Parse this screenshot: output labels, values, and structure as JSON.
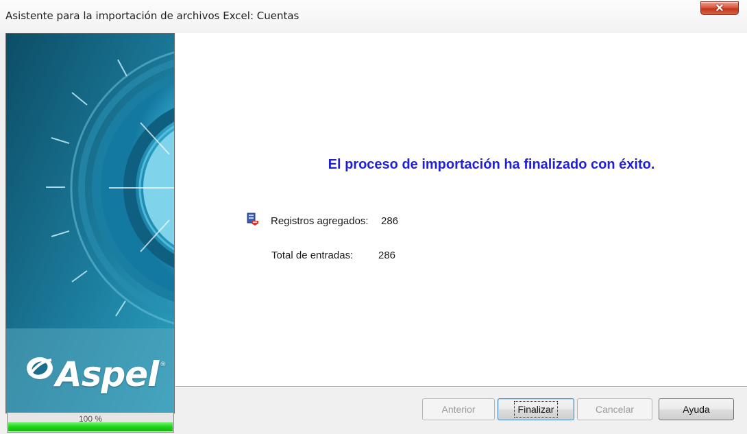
{
  "window": {
    "title": "Asistente para la importación de archivos Excel: Cuentas",
    "close_icon": "close-x-icon"
  },
  "banner": {
    "logo_text": "Aspel",
    "logo_registered": "®",
    "progress_label": "100 %",
    "progress_value": 1.0,
    "progress_color": "#1ed41a"
  },
  "main": {
    "headline": "El proceso de importación ha finalizado con éxito.",
    "headline_color": "#1f1fd8",
    "stats": {
      "records_icon": "records-added-icon",
      "records_added_label": "Registros agregados:",
      "records_added_value": "286",
      "total_entries_label": "Total de entradas:",
      "total_entries_value": "286"
    }
  },
  "buttons": {
    "previous": {
      "label": "Anterior",
      "enabled": false
    },
    "finish": {
      "label": "Finalizar",
      "enabled": true,
      "default": true
    },
    "cancel": {
      "label": "Cancelar",
      "enabled": false
    },
    "help": {
      "label": "Ayuda",
      "enabled": true
    }
  }
}
